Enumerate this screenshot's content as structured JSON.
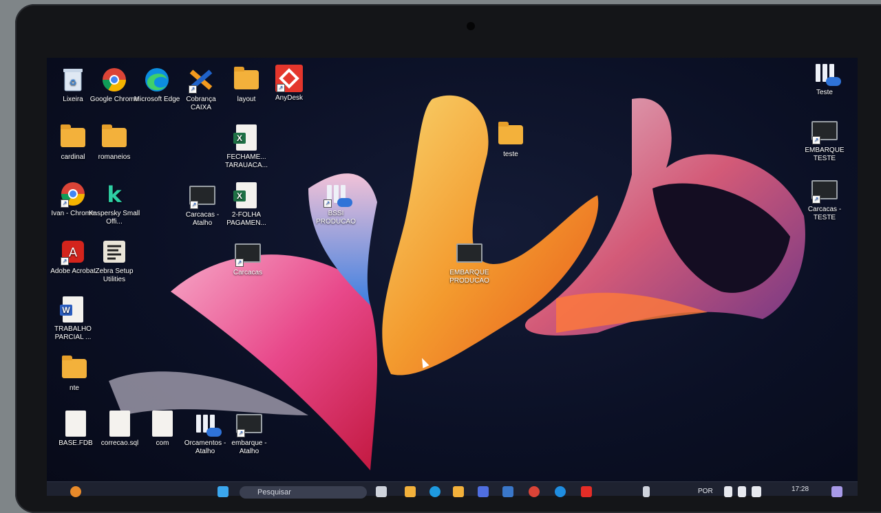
{
  "desktop_icons": {
    "lixeira": "Lixeira",
    "chrome": "Google Chrome",
    "edge": "Microsoft Edge",
    "cobranca": "Cobrança CAIXA",
    "layout": "layout",
    "anydesk": "AnyDesk",
    "teste_top": "Teste",
    "cardinal": "cardinal",
    "romaneios": "romaneios",
    "fechame": "FECHAME... TARAUACA...",
    "teste_folder": "teste",
    "embarque_teste": "EMBARQUE TESTE",
    "ivan_chrome": "Ivan - Chrome",
    "kaspersky": "Kaspersky Small Offi...",
    "carcacas_atalho": "Carcacas - Atalho",
    "folha": "2-FOLHA PAGAMEN...",
    "bssi": "BSSI PRODUCAO",
    "carcacas_teste": "Carcacas - TESTE",
    "adobe": "Adobe Acrobat",
    "zebra": "Zebra Setup Utilities",
    "carcacas": "Carcacas",
    "embarque_producao": "EMBARQUE PRODUCAO",
    "trabalho": "TRABALHO PARCIAL ...",
    "nte": "nte",
    "base": "BASE.FDB",
    "correcao": "correcao.sql",
    "com": "com",
    "orcamentos": "Orcamentos - Atalho",
    "embarque_atalho": "embarque - Atalho"
  },
  "taskbar": {
    "search_placeholder": "Pesquisar",
    "language": "POR",
    "clock": "17:28"
  },
  "colors": {
    "folder": "#f3b13b",
    "taskbar": "#1e2230",
    "accent_pink": "#e8488a",
    "accent_orange": "#f07a22"
  }
}
